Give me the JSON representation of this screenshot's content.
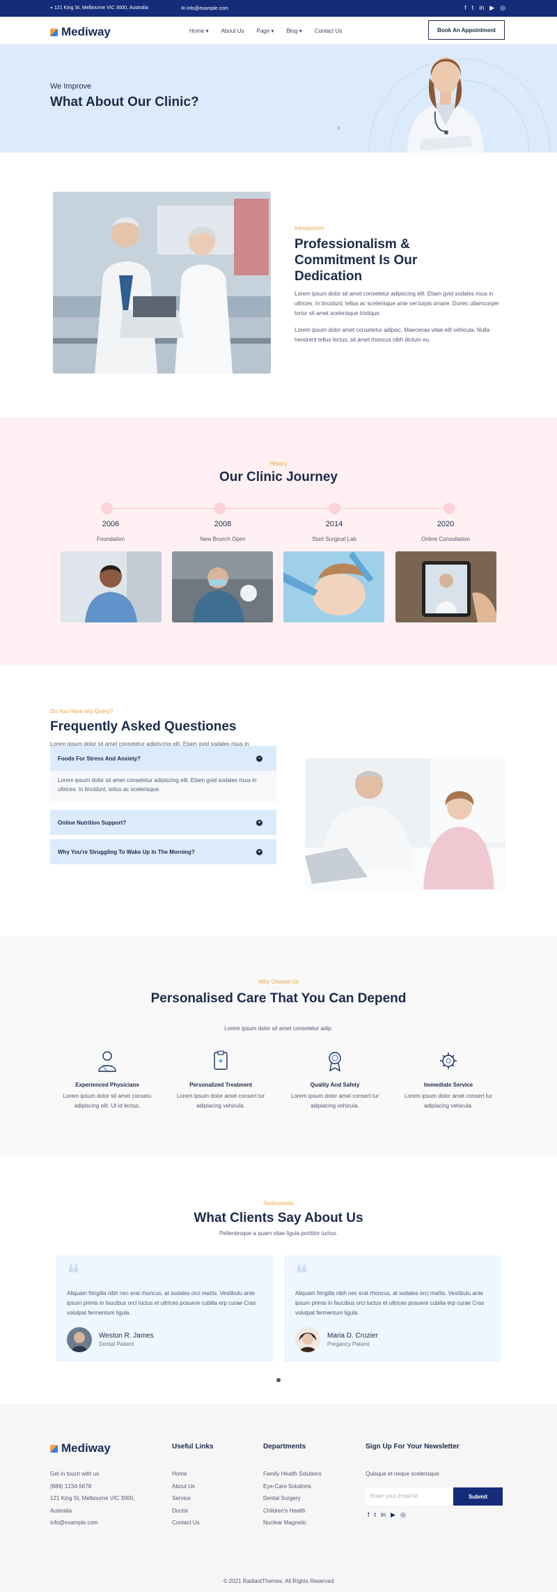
{
  "topbar": {
    "address": "121 King St, Melbourne VIC 3000, Australia",
    "email": "info@example.com",
    "social_icons": [
      "facebook-icon",
      "twitter-icon",
      "linkedin-icon",
      "youtube-icon",
      "instagram-icon"
    ]
  },
  "nav": {
    "brand": "Mediway",
    "items": [
      {
        "label": "Home",
        "dropdown": true
      },
      {
        "label": "About Us",
        "dropdown": false
      },
      {
        "label": "Page",
        "dropdown": true
      },
      {
        "label": "Blog",
        "dropdown": true
      },
      {
        "label": "Contact Us",
        "dropdown": false
      }
    ],
    "cta": "Book An Appointment"
  },
  "hero": {
    "eyebrow": "We Improve",
    "title": "What About Our Clinic?"
  },
  "intro": {
    "tag": "Introduction",
    "title": "Professionalism & Commitment Is Our Dedication",
    "p1": "Lorem ipsum dolor sit amet consetetur adipiscing elit. Etiam gvid sodales risus in ultrices. In tincidunt, tellus ac scelerisque ante vel turpis ornare. Donec ullamcorper tortor sit amet scelerisque tristique.",
    "p2": "Lorem ipsum dolor amet consetetur adipisc. Maecenas vitae elit vehicula. Nulla hendrerit tellus lectus, sit amet rhoncus nibh dictum eu."
  },
  "history": {
    "tag": "History",
    "title": "Our Clinic Journey",
    "milestones": [
      {
        "year": "2006",
        "caption": "Foundation"
      },
      {
        "year": "2008",
        "caption": "New Brunch Open"
      },
      {
        "year": "2014",
        "caption": "Start Surgical Lab"
      },
      {
        "year": "2020",
        "caption": "Online Consultation"
      }
    ]
  },
  "faq": {
    "tag": "Do You Have any Query?",
    "title": "Frequently Asked Questiones",
    "lead": "Lorem ipsum dolor sit amet consetetur adipiscing elit. Etiam gvid sodales risus in ultrices. In tincidunt, tellus ac scelerisque.",
    "items": [
      {
        "question": "Foods For Stress And Anxiety?",
        "expanded": true
      },
      {
        "question": "Online Nutrition Support?",
        "expanded": false
      },
      {
        "question": "Why You're Struggling To Wake Up In The Morning?",
        "expanded": false
      }
    ],
    "answer": "Lorem ipsum dolor sit amet consetetur adipiscing elit. Etiam gvid sodales risus in ultrices. In tincidunt, tellus ac scelerisque."
  },
  "why": {
    "tag": "Why Choose Us",
    "title": "Personalised Care That You Can Depend",
    "lead": "Lorem ipsum dolor sit amet consetetur adip.",
    "features": [
      {
        "icon": "physician-icon",
        "title": "Experienced Physicians",
        "text": "Lorem ipsum dolor sit amet consetu adipiscing elit. Ut id lectus."
      },
      {
        "icon": "clipboard-icon",
        "title": "Personalized Treatment",
        "text": "Lorem ipsum dolor amet consert tur adipiacing vehicula."
      },
      {
        "icon": "award-icon",
        "title": "Quality And Safety",
        "text": "Lorem ipsum dolor amet consert tur adipiacing vehicula."
      },
      {
        "icon": "virus-icon",
        "title": "Immediate Service",
        "text": "Lorem ipsum dolor amet consert tur adipiacing vehicula."
      }
    ]
  },
  "testimonials": {
    "tag": "Testimonials",
    "title": "What Clients Say About Us",
    "lead": "Pellentesque a quam vitae ligula porttitor luctus.",
    "items": [
      {
        "text": "Aliquam fringilla nibh nec erat rhoncus, at sodales orci mattis. Vestibulu ante ipsum primis in faucibus orci luctus et ultrices posuere cubilia erp curae Cras volutpat fermentum ligula.",
        "name": "Weston R. James",
        "role": "Dental Patient"
      },
      {
        "text": "Aliquam fringilla nibh nec erat rhoncus, at sodales orci mattis. Vestibulu ante ipsum primis in faucibus orci luctus et ultrices posuere cubilia erp curae Cras volutpat fermentum ligula.",
        "name": "Maria D. Crozier",
        "role": "Pregancy Patient"
      }
    ]
  },
  "footer": {
    "brand": "Mediway",
    "contact_heading": "Get in touch with us",
    "phone": "(888) 1234-5678",
    "address_line1": "121 King St, Melbourne VIC 3000,",
    "address_line2": "Australia",
    "email": "info@example.com",
    "useful_heading": "Useful Links",
    "useful_links": [
      "Home",
      "About Us",
      "Service",
      "Doctor",
      "Contact Us"
    ],
    "dept_heading": "Departments",
    "departments": [
      "Family Health Solutions",
      "Eye-Care Solutions",
      "Dental Surgery",
      "Children's Health",
      "Nuclear Magnetic"
    ],
    "newsletter_heading": "Sign Up For Your Newsletter",
    "newsletter_lead": "Quisque et neque scelerisque.",
    "email_placeholder": "Enter your Email Id",
    "submit_label": "Submit",
    "copyright": "© 2021 RadiantThemes. All Rights Reserved"
  },
  "colors": {
    "navy": "#152c7a",
    "accent": "#e8a33c",
    "hero_bg": "#dcebfb",
    "history_bg": "#fff1f3"
  }
}
